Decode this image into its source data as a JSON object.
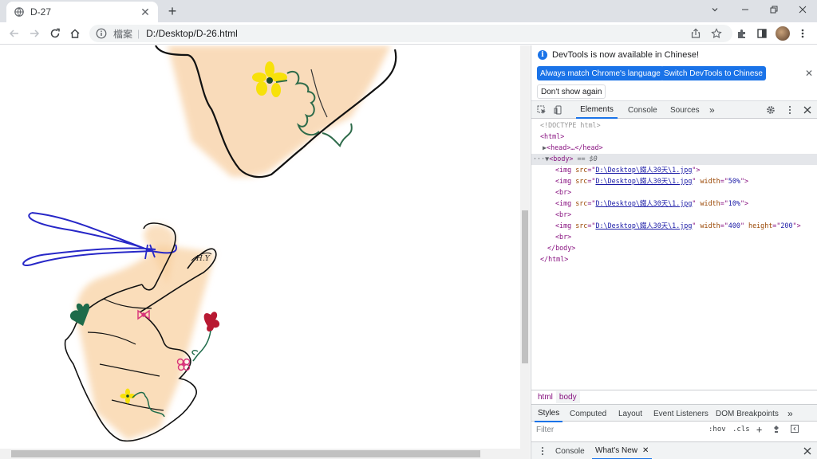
{
  "browser": {
    "tab_title": "D-27",
    "new_tab": "+",
    "url_scheme_label": "檔案",
    "url": "D:/Desktop/D-26.html"
  },
  "devtools": {
    "notice": "DevTools is now available in Chinese!",
    "btn_match": "Always match Chrome's language",
    "btn_switch": "Switch DevTools to Chinese",
    "btn_dont_show": "Don't show again",
    "tabs": [
      "Elements",
      "Console",
      "Sources",
      "»"
    ],
    "dom": {
      "doctype": "<!DOCTYPE html>",
      "html_open": "<html>",
      "head": "<head>…</head>",
      "body_open": "<body>",
      "body_marker": "== $0",
      "img_src": "D:\\Desktop\\鐵人30天\\1.jpg",
      "w1": "50%",
      "w2": "10%",
      "w3": "400",
      "h3": "200",
      "br": "<br>",
      "body_close": "</body>",
      "html_close": "</html>"
    },
    "crumbs": [
      "html",
      "body"
    ],
    "style_tabs": [
      "Styles",
      "Computed",
      "Layout",
      "Event Listeners",
      "DOM Breakpoints",
      "»"
    ],
    "filter_placeholder": "Filter",
    "hov": ":hov",
    "cls": ".cls",
    "drawer_tabs": [
      "Console",
      "What's New"
    ]
  }
}
